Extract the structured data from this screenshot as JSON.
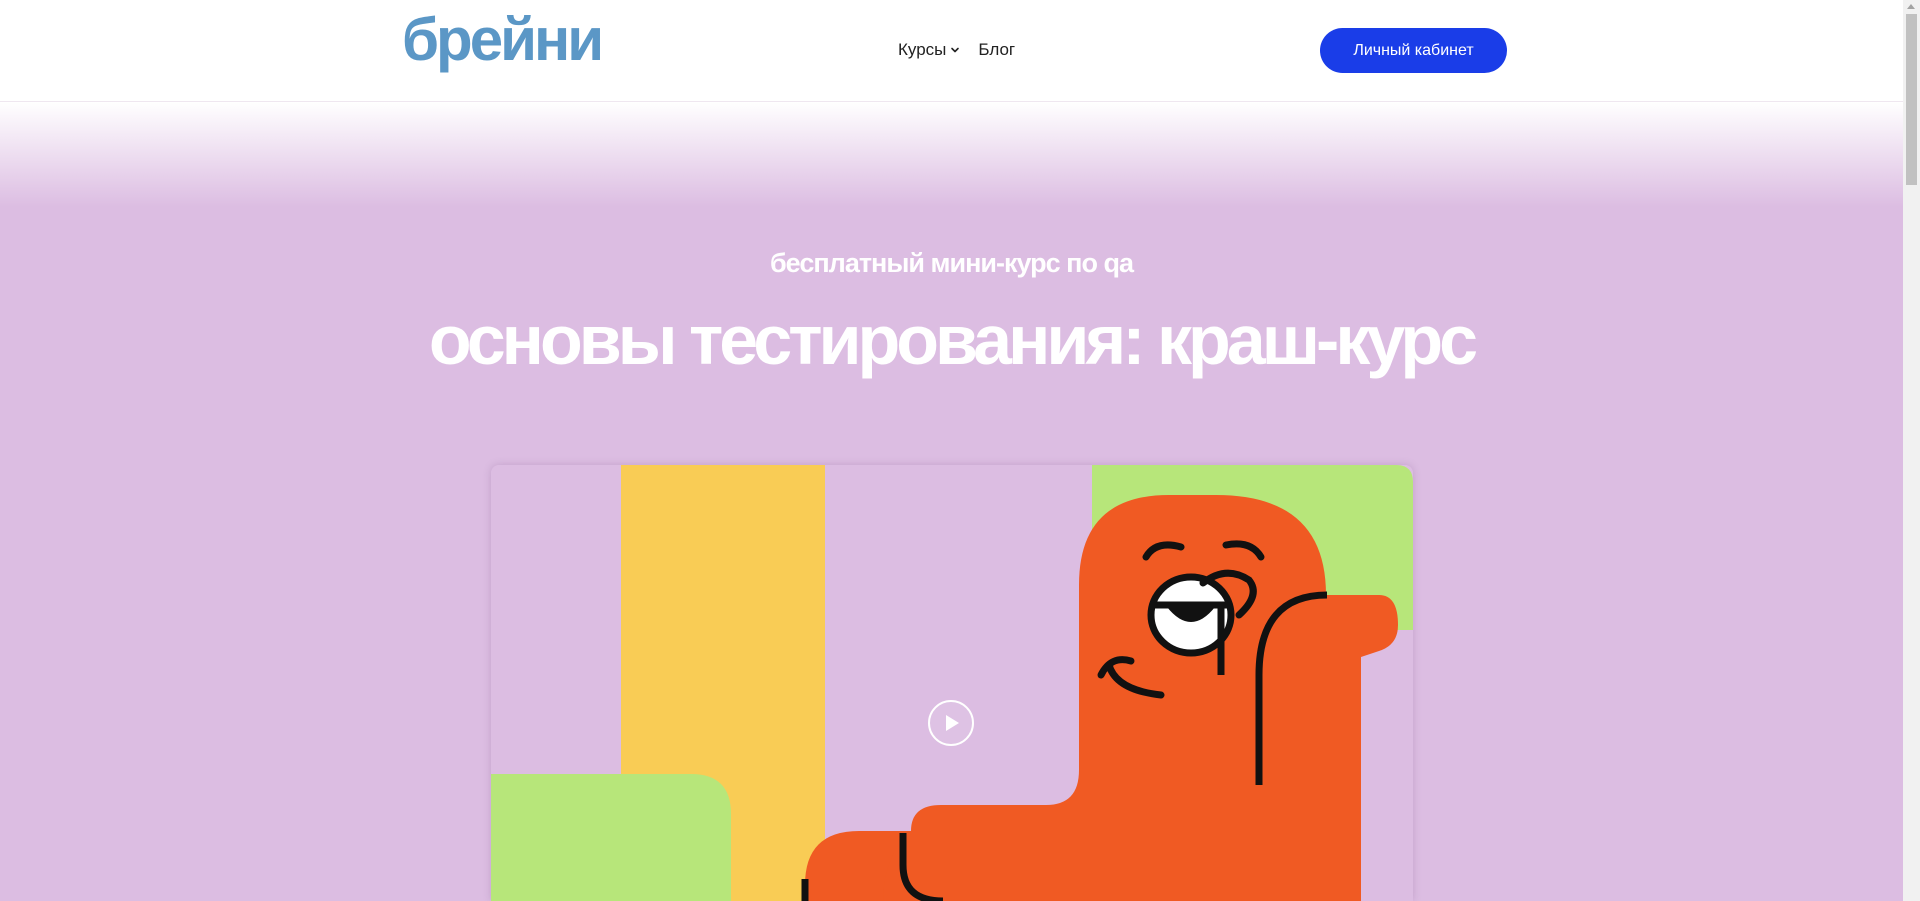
{
  "header": {
    "logo_text": "брейни",
    "nav": [
      {
        "label": "Курсы",
        "has_dropdown": true
      },
      {
        "label": "Блог",
        "has_dropdown": false
      }
    ],
    "cabinet_button": "Личный кабинет"
  },
  "hero": {
    "subtitle": "бесплатный мини-курс по qa",
    "title": "основы тестирования: краш-курс"
  },
  "video": {
    "play_icon": "play-icon"
  },
  "colors": {
    "brand_blue": "#5b97c6",
    "button_blue": "#1a3de8",
    "hero_bg": "#dcbde2",
    "orange": "#f05a23",
    "yellow": "#f9cc55",
    "green": "#b7e67a"
  }
}
